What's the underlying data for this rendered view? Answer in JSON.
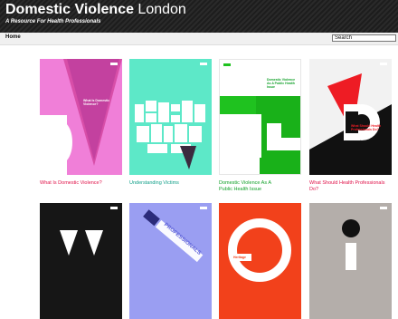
{
  "header": {
    "title_bold": "Domestic Violence",
    "title_light": " London",
    "tagline": "A Resource For Health Professionals"
  },
  "nav": {
    "home": "Home"
  },
  "search": {
    "value": "Search"
  },
  "cards": [
    {
      "caption": "What Is Domestic Violence?",
      "caption_color": "#e0134a",
      "cover_text": "What Is Domestic Violence?"
    },
    {
      "caption": "Understanding Victims",
      "caption_color": "#13a08a",
      "cover_text": "UNDERSTAN"
    },
    {
      "caption": "Domestic Violence As A Public Health Issue",
      "caption_color": "#12a12a",
      "cover_text": "Domestic Violence As A Public Health Issue"
    },
    {
      "caption": "What Should Health Professionals Do?",
      "caption_color": "#e0134a",
      "cover_text": "What Should Health Professionals Do?"
    },
    {
      "caption": "",
      "caption_color": "#111111",
      "cover_text": ""
    },
    {
      "caption": "",
      "caption_color": "#111111",
      "cover_text": "PROFESSIONALS"
    },
    {
      "caption": "",
      "caption_color": "#111111",
      "cover_text": "Heritage"
    },
    {
      "caption": "",
      "caption_color": "#111111",
      "cover_text": ""
    }
  ]
}
